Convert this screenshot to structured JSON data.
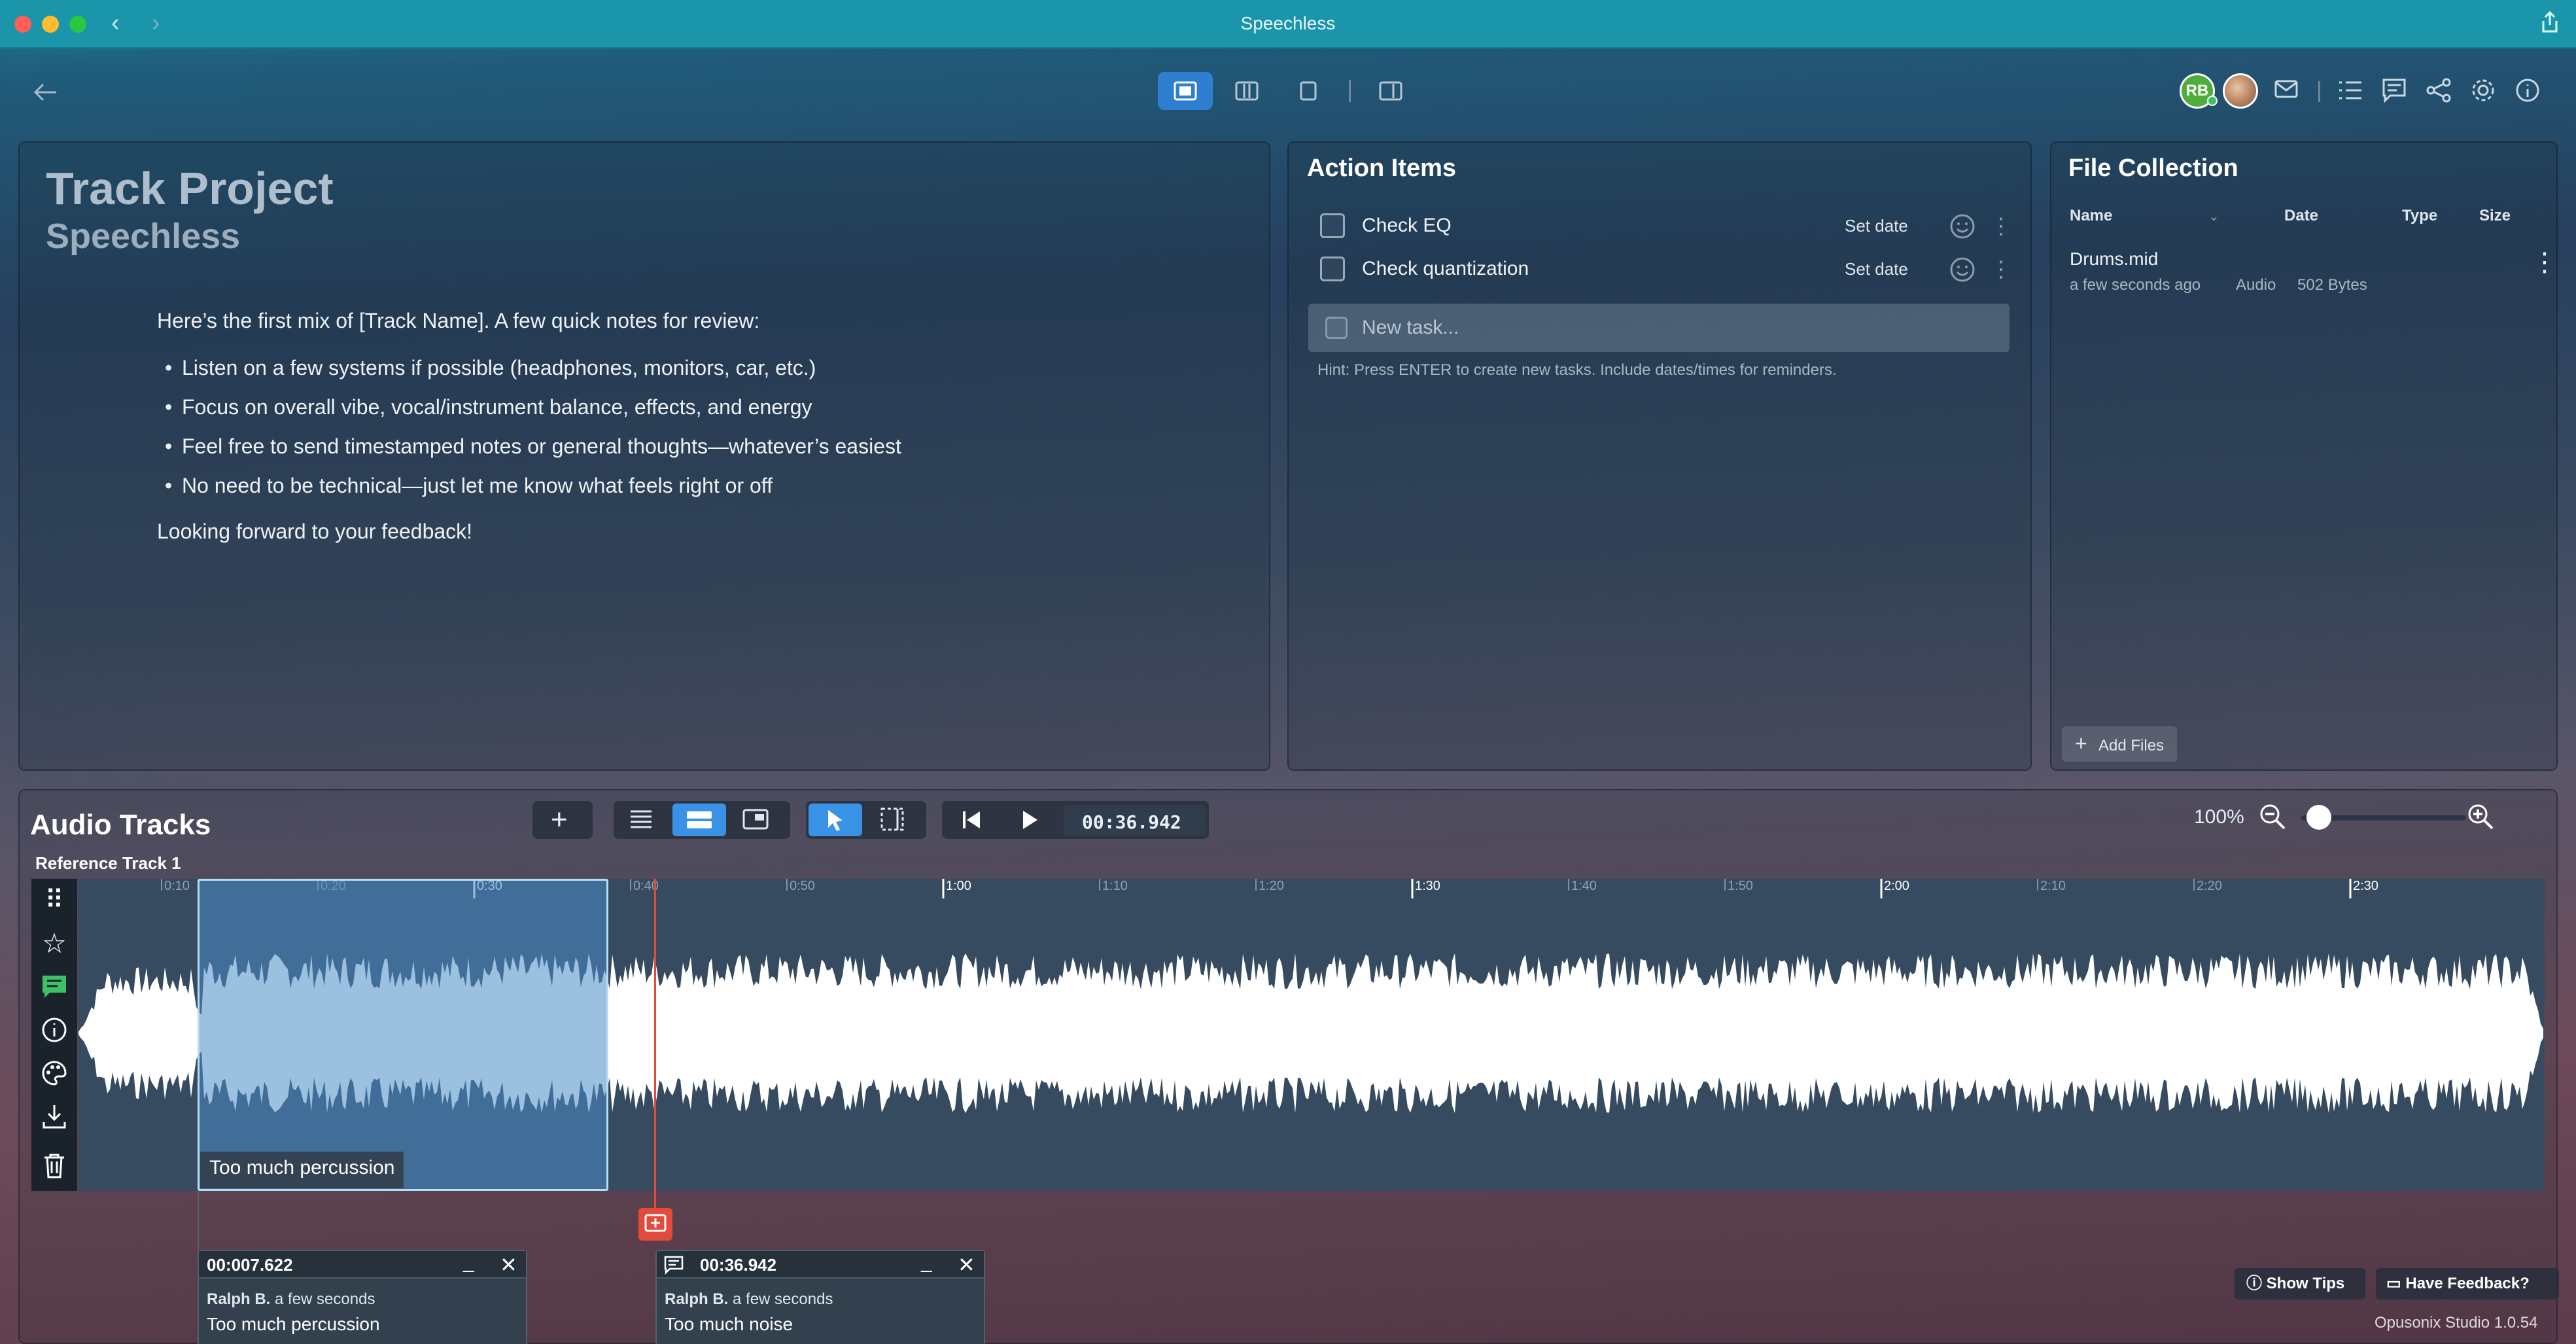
{
  "window": {
    "title": "Speechless"
  },
  "project": {
    "title": "Track Project",
    "subtitle": "Speechless"
  },
  "notes": {
    "intro": "Here’s the first mix of [Track Name]. A few quick notes for review:",
    "bullets": [
      "Listen on a few systems if possible (headphones, monitors, car, etc.)",
      "Focus on overall vibe, vocal/instrument balance, effects, and energy",
      "Feel free to send timestamped notes or general thoughts—whatever’s easiest",
      "No need to be technical—just let me know what feels right or off"
    ],
    "closing": "Looking forward to your feedback!"
  },
  "action_items": {
    "title": "Action Items",
    "tasks": [
      {
        "label": "Check EQ",
        "date": "Set date"
      },
      {
        "label": "Check quantization",
        "date": "Set date"
      }
    ],
    "new_task_placeholder": "New task...",
    "hint": "Hint: Press ENTER to create new tasks. Include dates/times for reminders."
  },
  "files": {
    "title": "File Collection",
    "columns": [
      "Name",
      "Date",
      "Type",
      "Size"
    ],
    "items": [
      {
        "name": "Drums.mid",
        "date": "a few seconds ago",
        "type": "Audio",
        "size": "502 Bytes"
      }
    ],
    "add_label": "Add Files"
  },
  "header": {
    "avatar_initials": "RB"
  },
  "audio": {
    "title": "Audio Tracks",
    "track_name": "Reference Track 1",
    "time": "00:36.942",
    "zoom": "100%",
    "ruler": [
      "0:10",
      "0:20",
      "0:30",
      "0:40",
      "0:50",
      "1:00",
      "1:10",
      "1:20",
      "1:30",
      "1:40",
      "1:50",
      "2:00",
      "2:10",
      "2:20",
      "2:30"
    ],
    "region_label": "Too much percussion",
    "comments": [
      {
        "time": "00:007.622",
        "author": "Ralph B.",
        "ago": "a few seconds",
        "text": "Too much percussion"
      },
      {
        "time": "00:36.942",
        "author": "Ralph B.",
        "ago": "a few seconds",
        "text": "Too much noise"
      }
    ]
  },
  "footer": {
    "show_tips": "Show Tips",
    "feedback": "Have Feedback?",
    "version": "Opusonix Studio 1.0.54"
  },
  "colors": {
    "accent": "#3a92e6",
    "playhead": "#e24a3c",
    "comment_green": "#3fbf67",
    "titlebar": "#1a95aa"
  }
}
